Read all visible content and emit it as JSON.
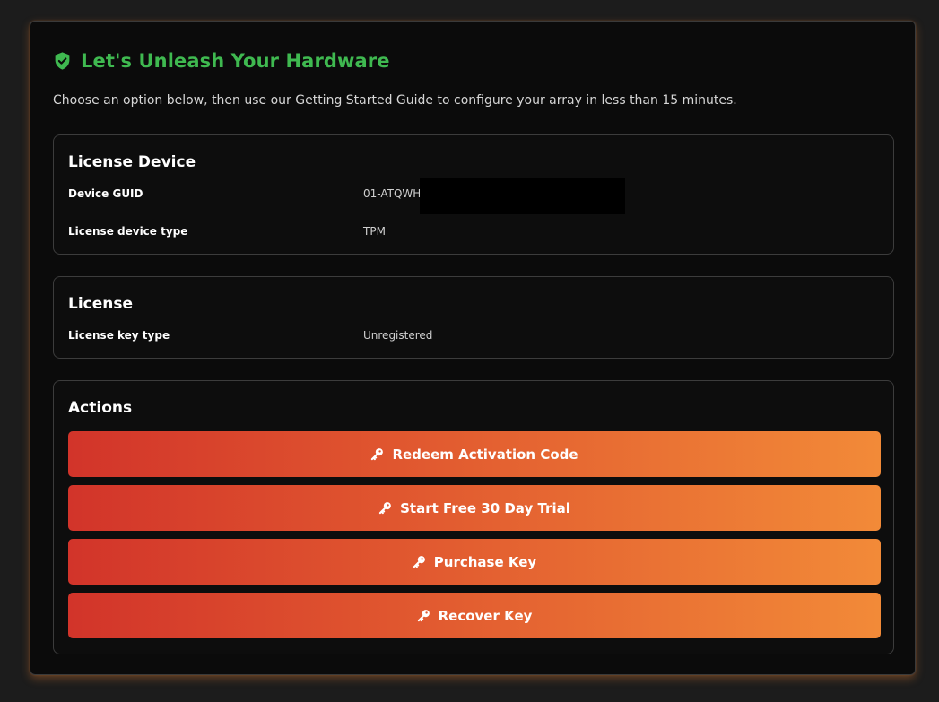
{
  "header": {
    "title": "Let's Unleash Your Hardware",
    "icon": "shield-check-icon",
    "title_color": "#3fb950"
  },
  "subtitle": "Choose an option below, then use our Getting Started Guide to configure your array in less than 15 minutes.",
  "license_device": {
    "title": "License Device",
    "rows": [
      {
        "label": "Device GUID",
        "value": "01-ATQWH"
      },
      {
        "label": "License device type",
        "value": "TPM"
      }
    ]
  },
  "license": {
    "title": "License",
    "rows": [
      {
        "label": "License key type",
        "value": "Unregistered"
      }
    ]
  },
  "actions": {
    "title": "Actions",
    "button_icon": "key-icon",
    "gradient": [
      "#d2342a",
      "#f28a38"
    ],
    "buttons": [
      {
        "label": "Redeem Activation Code"
      },
      {
        "label": "Start Free 30 Day Trial"
      },
      {
        "label": "Purchase Key"
      },
      {
        "label": "Recover Key"
      }
    ]
  }
}
